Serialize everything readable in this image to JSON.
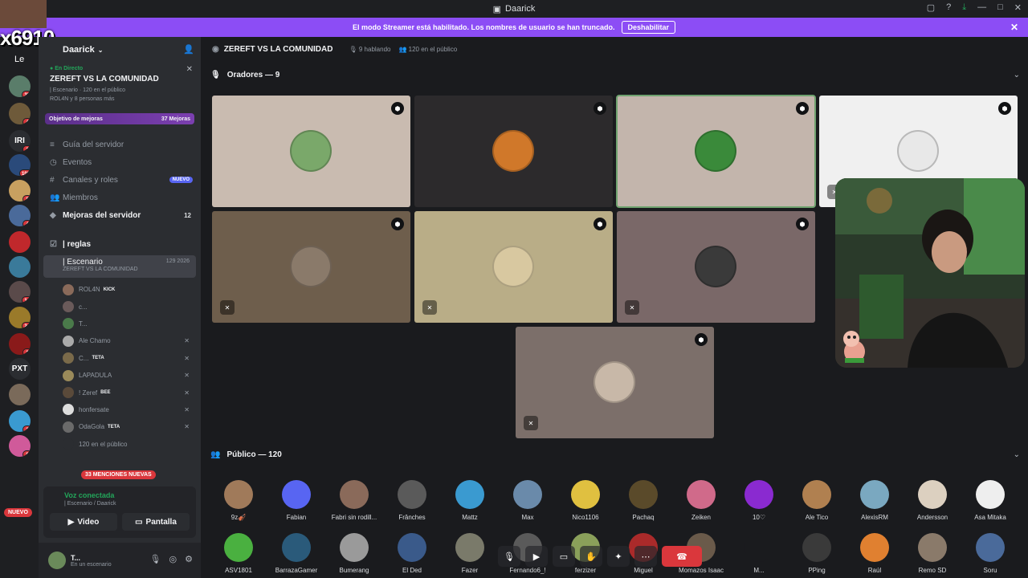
{
  "window": {
    "title": "Daarick"
  },
  "streamer_bar": {
    "message": "El modo Streamer está habilitado. Los nombres de usuario se han truncado.",
    "button": "Deshabilitar"
  },
  "overlay": {
    "handle": "x6910",
    "sub": "Le"
  },
  "rail": {
    "guilds": [
      {
        "label": "",
        "color": "#5a7d6a",
        "badge": "33"
      },
      {
        "label": "",
        "color": "#6e5a3a",
        "badge": "4"
      },
      {
        "label": "IRI",
        "color": "#2b2d31",
        "badge": "1"
      },
      {
        "label": "",
        "color": "#2a4a7a",
        "badge": "103"
      },
      {
        "label": "",
        "color": "#c8a060",
        "badge": "8"
      },
      {
        "label": "",
        "color": "#4a6a9a",
        "badge": "4"
      },
      {
        "label": "",
        "color": "#c0282c",
        "badge": ""
      },
      {
        "label": "",
        "color": "#3a7a9a",
        "badge": ""
      },
      {
        "label": "",
        "color": "#5a4a4a",
        "badge": "14"
      },
      {
        "label": "",
        "color": "#9a7a2a",
        "badge": "24"
      },
      {
        "label": "",
        "color": "#8a1a1a",
        "badge": "1"
      },
      {
        "label": "PXT",
        "color": "#2b2d31",
        "badge": ""
      },
      {
        "label": "",
        "color": "#7a6a5a",
        "badge": ""
      },
      {
        "label": "",
        "color": "#3a9ad0",
        "badge": "3"
      },
      {
        "label": "",
        "color": "#d05a9a",
        "badge": "8"
      }
    ],
    "new_label": "NUEVO"
  },
  "sidebar": {
    "server_name": "Daarick",
    "live": {
      "tag": "En Directo",
      "title": "ZEREFT VS LA COMUNIDAD",
      "sub1": "| Escenario · 120 en el público",
      "sub2": "ROL4N y 8 personas más"
    },
    "goal": {
      "label": "Objetivo de mejoras",
      "value": "37 Mejoras"
    },
    "items": [
      {
        "icon": "≡",
        "label": "Guía del servidor",
        "pill": "",
        "num": "",
        "bold": false
      },
      {
        "icon": "◷",
        "label": "Eventos",
        "pill": "",
        "num": "",
        "bold": false
      },
      {
        "icon": "#",
        "label": "Canales y roles",
        "pill": "NUEVO",
        "num": "",
        "bold": false
      },
      {
        "icon": "👥",
        "label": "Miembros",
        "pill": "",
        "num": "",
        "bold": false
      },
      {
        "icon": "◆",
        "label": "Mejoras del servidor",
        "pill": "",
        "num": "12",
        "bold": true
      }
    ],
    "rules_channel": "| reglas",
    "stage": {
      "name": "| Escenario",
      "topic": "ZEREFT VS LA COMUNIDAD",
      "count": "129   2026"
    },
    "members": [
      {
        "name": "ROL4N",
        "tag": "KICK",
        "color": "#8a6a5a",
        "muted": false
      },
      {
        "name": "c...",
        "tag": "",
        "color": "#6a5a5a",
        "muted": false
      },
      {
        "name": "T...",
        "tag": "",
        "color": "#4a7a4a",
        "muted": false
      },
      {
        "name": "Ale Chamo",
        "tag": "",
        "color": "#aaaaaa",
        "muted": true
      },
      {
        "name": "C...",
        "tag": "TETA",
        "color": "#7a6a4a",
        "muted": true
      },
      {
        "name": "LAPADULA",
        "tag": "",
        "color": "#9a8a5a",
        "muted": true
      },
      {
        "name": "! Zeref",
        "tag": "BEE",
        "color": "#5a4a3a",
        "muted": true
      },
      {
        "name": "honfersate",
        "tag": "",
        "color": "#dddddd",
        "muted": true
      },
      {
        "name": "OdaGola",
        "tag": "TETA",
        "color": "#6a6a6a",
        "muted": true
      },
      {
        "name": "120 en el público",
        "tag": "",
        "color": "#2b2d31",
        "muted": false
      }
    ],
    "mentions": "33 MENCIONES NUEVAS",
    "voice": {
      "status": "Voz conectada",
      "sub": "| Escenario / Daarick",
      "video": "Video",
      "screen": "Pantalla"
    },
    "user": {
      "name": "T...",
      "status": "En un escenario"
    }
  },
  "main": {
    "header": {
      "title": "ZEREFT VS LA COMUNIDAD",
      "speaking": "9 hablando",
      "audience": "120 en el público"
    },
    "speakers_header": "Oradores — 9",
    "audience_header": "Público — 120",
    "speakers": [
      {
        "bg": "#c9bbb0",
        "av": "#7aa86a",
        "muted": false,
        "speaking": false
      },
      {
        "bg": "#2c2a2c",
        "av": "#d0782a",
        "muted": false,
        "speaking": false
      },
      {
        "bg": "#c3b5ac",
        "av": "#3a8a3a",
        "muted": false,
        "speaking": true
      },
      {
        "bg": "#f0f0f0",
        "av": "#e8e8e8",
        "muted": true,
        "speaking": false
      },
      {
        "bg": "#6e5e4c",
        "av": "#8a7a6a",
        "muted": true,
        "speaking": false
      },
      {
        "bg": "#b9ad87",
        "av": "#d8c8a0",
        "muted": true,
        "speaking": false
      },
      {
        "bg": "#7a6868",
        "av": "#3a3a3a",
        "muted": true,
        "speaking": false
      },
      {
        "bg": "#7c6f6a",
        "av": "#c8b8a8",
        "muted": true,
        "speaking": false
      }
    ],
    "audience": [
      {
        "name": "9z🎻",
        "color": "#a07a5a"
      },
      {
        "name": "Fabian",
        "color": "#5865f2"
      },
      {
        "name": "Fabri sin rodill...",
        "color": "#8a6a5a"
      },
      {
        "name": "Frânches",
        "color": "#5a5a5a"
      },
      {
        "name": "Mattz",
        "color": "#3a9ad0"
      },
      {
        "name": "Max",
        "color": "#6a8aaa"
      },
      {
        "name": "Nico1106",
        "color": "#e0c040"
      },
      {
        "name": "Pachaq",
        "color": "#5a4a2a"
      },
      {
        "name": "Zeiken",
        "color": "#d06a8a"
      },
      {
        "name": "10♡",
        "color": "#8a2ad0"
      },
      {
        "name": "Ale Tico",
        "color": "#b08050"
      },
      {
        "name": "AlexisRM",
        "color": "#7aa8c0"
      },
      {
        "name": "Andersson",
        "color": "#dcd0c0"
      },
      {
        "name": "Asa Mitaka",
        "color": "#eeeeee"
      },
      {
        "name": "ASV1801",
        "color": "#4ab040"
      },
      {
        "name": "BarrazaGamer",
        "color": "#2a5a7a"
      },
      {
        "name": "Bumerang",
        "color": "#9a9a9a"
      },
      {
        "name": "El Ded",
        "color": "#3a5a8a"
      },
      {
        "name": "Fazer",
        "color": "#7a7a6a"
      },
      {
        "name": "Fernando6_!",
        "color": "#5a5a5a"
      },
      {
        "name": "ferzizer",
        "color": "#8aa05a"
      },
      {
        "name": "Miguel",
        "color": "#aa2a2a"
      },
      {
        "name": "Momazos Isaac",
        "color": "#6a5a4a"
      },
      {
        "name": "M...",
        "color": "#1a1b1e"
      },
      {
        "name": "PPing",
        "color": "#3a3a3a"
      },
      {
        "name": "Raúl",
        "color": "#e08030"
      },
      {
        "name": "Remo SD",
        "color": "#8a7a6a"
      },
      {
        "name": "Soru",
        "color": "#4a6a9a"
      }
    ]
  }
}
